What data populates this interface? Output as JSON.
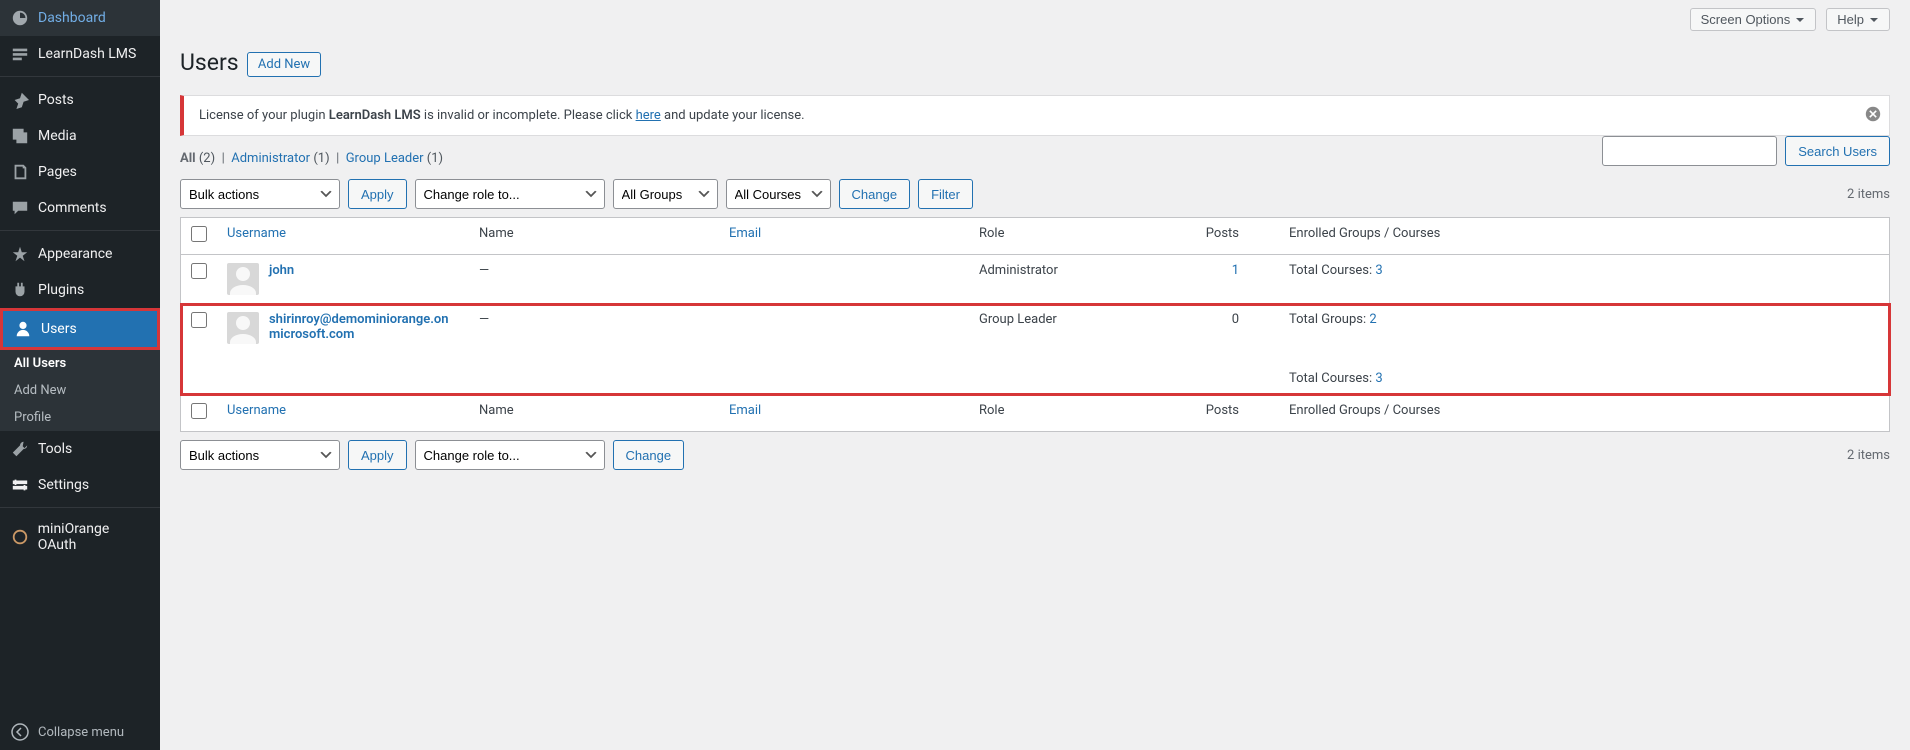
{
  "topbar": {
    "screen_options": "Screen Options",
    "help": "Help"
  },
  "sidebar": {
    "dashboard": "Dashboard",
    "learndash": "LearnDash LMS",
    "posts": "Posts",
    "media": "Media",
    "pages": "Pages",
    "comments": "Comments",
    "appearance": "Appearance",
    "plugins": "Plugins",
    "users": "Users",
    "tools": "Tools",
    "settings": "Settings",
    "miniorange": "miniOrange OAuth",
    "collapse": "Collapse menu",
    "submenu": {
      "all_users": "All Users",
      "add_new": "Add New",
      "profile": "Profile"
    }
  },
  "page": {
    "title": "Users",
    "add_new": "Add New"
  },
  "notice": {
    "prefix": "License of your plugin ",
    "plugin": "LearnDash LMS",
    "middle": " is invalid or incomplete. Please click ",
    "link": "here",
    "suffix": " and update your license."
  },
  "filters": {
    "all": "All",
    "all_count": "(2)",
    "admin": "Administrator",
    "admin_count": "(1)",
    "group_leader": "Group Leader",
    "group_leader_count": "(1)"
  },
  "search": {
    "button": "Search Users"
  },
  "bulk": {
    "actions": "Bulk actions",
    "apply": "Apply",
    "change_role": "Change role to...",
    "change": "Change",
    "all_groups": "All Groups",
    "all_courses": "All Courses",
    "filter": "Filter"
  },
  "count": {
    "items": "2 items"
  },
  "table": {
    "username": "Username",
    "name": "Name",
    "email": "Email",
    "role": "Role",
    "posts": "Posts",
    "enrolled": "Enrolled Groups / Courses"
  },
  "rows": [
    {
      "username": "john",
      "name": "—",
      "email": "",
      "role": "Administrator",
      "posts": "1",
      "posts_link": true,
      "groups_label": "",
      "groups": "",
      "courses_label": "Total Courses: ",
      "courses": "3",
      "highlight": false
    },
    {
      "username": "shirinroy@demominiorange.onmicrosoft.com",
      "name": "—",
      "email": "",
      "role": "Group Leader",
      "posts": "0",
      "posts_link": false,
      "groups_label": "Total Groups: ",
      "groups": "2",
      "courses_label": "Total Courses: ",
      "courses": "3",
      "highlight": true
    }
  ]
}
